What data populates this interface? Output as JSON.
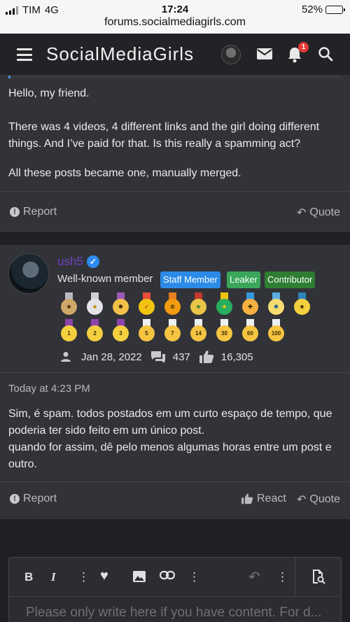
{
  "status_bar": {
    "carrier": "TIM",
    "network": "4G",
    "time": "17:24",
    "battery": "52%",
    "battery_level": 0.52
  },
  "browser": {
    "url": "forums.socialmediagirls.com"
  },
  "header": {
    "site_name": "SocialMediaGirls",
    "notification_count": "1"
  },
  "post1": {
    "lines": [
      "Hello, my friend.",
      "There was 4 videos, 4 different links and the girl doing different things. And I’ve paid for that. Is this really a spamming act?",
      "All these posts became one, manually merged."
    ],
    "report_label": "Report",
    "quote_label": "Quote"
  },
  "post2": {
    "username": "ush5",
    "user_title": "Well-known member",
    "tags": [
      "Staff Member",
      "Leaker",
      "Contributor"
    ],
    "tag_colors": [
      "#2b8be6",
      "#3aa65a",
      "#2e7d32"
    ],
    "medal_labels": [
      "5",
      "7",
      "14",
      "30",
      "60",
      "100"
    ],
    "joined": "Jan 28, 2022",
    "messages": "437",
    "reactions": "16,305",
    "timestamp": "Today at 4:23 PM",
    "body": [
      "Sim, é spam. todos postados em um curto espaço de tempo, que poderia ter sido feito em um único post.",
      "quando for assim, dê pelo menos algumas horas entre um post e outro."
    ],
    "report_label": "Report",
    "react_label": "React",
    "quote_label": "Quote"
  },
  "editor": {
    "bold": "B",
    "italic": "I",
    "placeholder": "Please only write here if you have content. For d..."
  },
  "colors": {
    "accent": "#2d8cf0",
    "username": "#6f42c1",
    "notification": "#e53935"
  }
}
